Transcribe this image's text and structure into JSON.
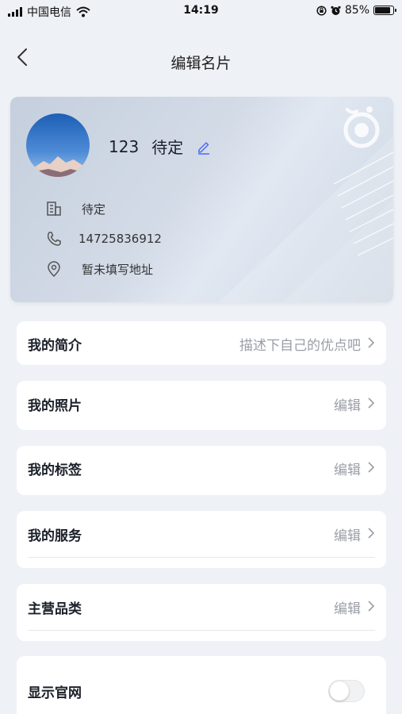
{
  "status_bar": {
    "carrier": "中国电信",
    "time": "14:19",
    "battery_text": "85%",
    "battery_level": 0.85,
    "icons": [
      "signal-icon",
      "wifi-icon",
      "rotation-lock-icon",
      "alarm-icon",
      "battery-icon"
    ]
  },
  "nav": {
    "title": "编辑名片",
    "back_icon": "back-chevron-icon"
  },
  "card": {
    "name": "123",
    "status": "待定",
    "edit_icon": "pencil-icon",
    "company": "待定",
    "phone": "14725836912",
    "address": "暂未填写地址",
    "icons": [
      "building-icon",
      "phone-icon",
      "location-icon"
    ]
  },
  "sections": {
    "intro": {
      "label": "我的简介",
      "value": "描述下自己的优点吧"
    },
    "photos": {
      "label": "我的照片",
      "value": "编辑"
    },
    "tags": {
      "label": "我的标签",
      "value": "编辑"
    },
    "services": {
      "label": "我的服务",
      "value": "编辑"
    },
    "categories": {
      "label": "主营品类",
      "value": "编辑"
    },
    "website": {
      "label": "显示官网",
      "enabled": false
    }
  },
  "colors": {
    "background": "#eef1f6",
    "card_gradient_start": "#c5cfdd",
    "card_gradient_end": "#e1e8f2",
    "accent": "#4a6cf7",
    "muted_text": "#9a9ea6"
  }
}
